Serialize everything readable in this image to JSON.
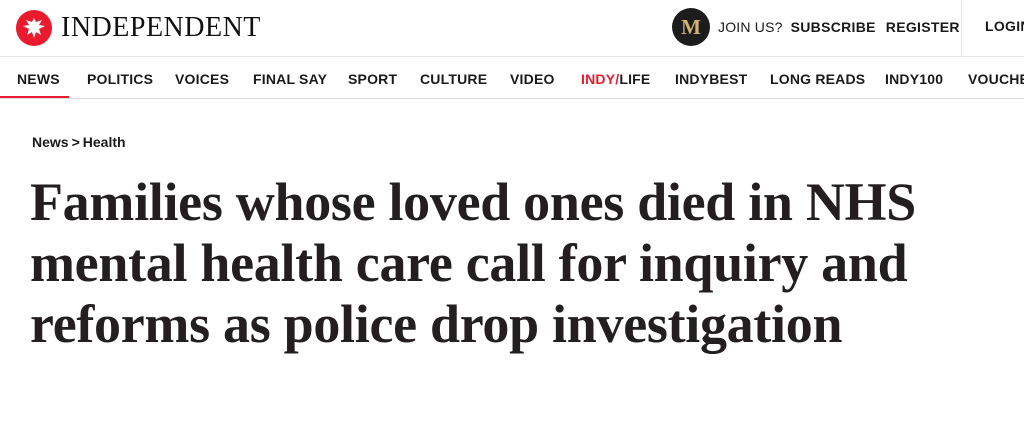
{
  "brand": {
    "logo_text": "INDEPENDENT",
    "logo_color": "#ec1a2e",
    "logo_icon": "eagle-icon"
  },
  "header": {
    "membership_badge": "M",
    "join_label": "JOIN US?",
    "subscribe_label": "SUBSCRIBE",
    "register_label": "REGISTER",
    "login_label": "LOGIN"
  },
  "nav": {
    "items": [
      {
        "label": "NEWS",
        "active": true
      },
      {
        "label": "POLITICS"
      },
      {
        "label": "VOICES"
      },
      {
        "label": "FINAL SAY"
      },
      {
        "label": "SPORT"
      },
      {
        "label": "CULTURE"
      },
      {
        "label": "VIDEO"
      },
      {
        "label_prefix": "INDY/",
        "label_suffix": "LIFE"
      },
      {
        "label": "INDYBEST"
      },
      {
        "label": "LONG READS"
      },
      {
        "label": "INDY100"
      },
      {
        "label": "VOUCHERS"
      }
    ],
    "accent_color": "#ec1a2e"
  },
  "article": {
    "breadcrumb": [
      "News",
      ">",
      "Health"
    ],
    "headline": "Families whose loved ones died in NHS mental health care call for inquiry and reforms as police drop investigation"
  }
}
